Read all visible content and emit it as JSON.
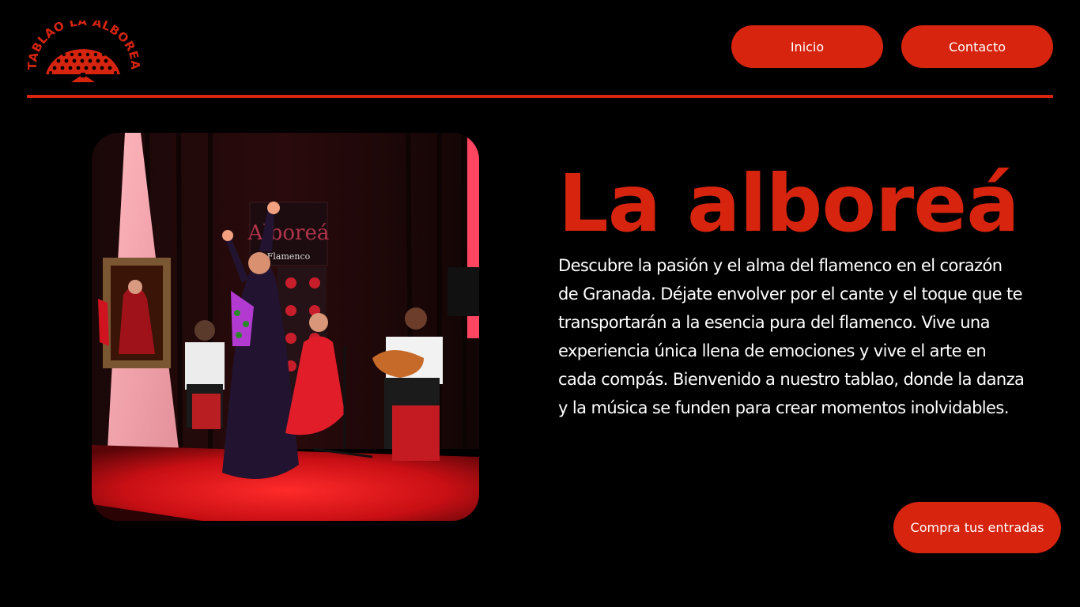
{
  "header": {
    "logo_text": "TABLAO LA ALBOREÁ",
    "nav": {
      "home_label": "Inicio",
      "contact_label": "Contacto"
    }
  },
  "hero": {
    "title": "La alboreá",
    "description": "Descubre la pasión y el alma del flamenco en el corazón de Granada. Déjate envolver por el cante y el toque que te transportarán a la esencia pura del flamenco. Vive una experiencia única llena de emociones y vive el arte en cada compás. Bienvenido a nuestro tablao, donde la danza y la música se funden para crear momentos inolvidables.",
    "cta_label": "Compra tus entradas",
    "photo_banner_text": "Alboreá Flamenco"
  },
  "colors": {
    "accent": "#d6240f",
    "background": "#000000",
    "text": "#ffffff"
  },
  "icons": {
    "logo": "fan-logo-icon"
  }
}
